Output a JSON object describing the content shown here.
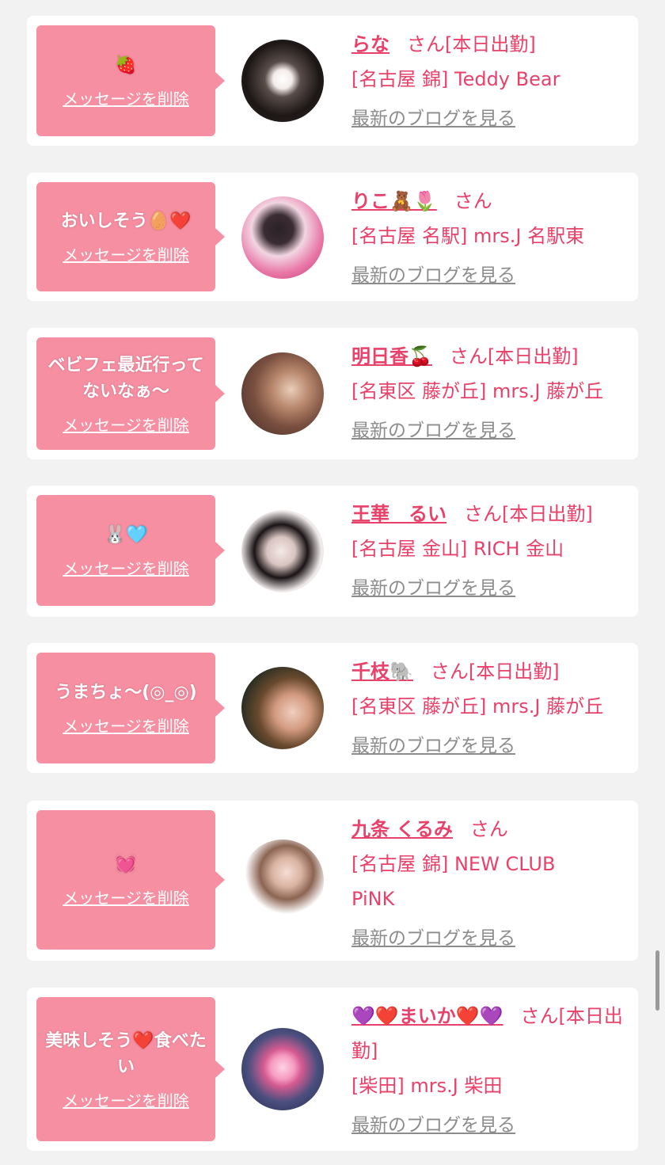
{
  "delete_label": "メッセージを削除",
  "blog_label": "最新のブログを見る",
  "colors": {
    "bubble": "#f68fa2",
    "accent": "#e8416a",
    "muted": "#8c8c8c"
  },
  "messages": [
    {
      "text": "🍓",
      "name": "らな",
      "honorific": "さん[本日出勤]",
      "shop": "[名古屋 錦] Teddy Bear"
    },
    {
      "text": "おいしそう🥚❤️",
      "name": "りこ🧸🌷",
      "honorific": "さん",
      "shop": "[名古屋 名駅] mrs.J 名駅東"
    },
    {
      "text": "ベビフェ最近行ってないなぁ〜",
      "name": "明日香🍒",
      "honorific": "さん[本日出勤]",
      "shop": "[名東区 藤が丘] mrs.J 藤が丘"
    },
    {
      "text": "🐰🩵",
      "name": "王華　るい",
      "honorific": "さん[本日出勤]",
      "shop": "[名古屋 金山] RICH 金山"
    },
    {
      "text": "うまちょ〜(◎_◎)",
      "name": "千枝🐘",
      "honorific": "さん[本日出勤]",
      "shop": "[名東区 藤が丘] mrs.J 藤が丘"
    },
    {
      "text": "💓",
      "name": "九条 くるみ",
      "honorific": "さん",
      "shop": "[名古屋 錦] NEW CLUB PiNK"
    },
    {
      "text": "美味しそう❤️食べたい",
      "name": "💜❤️まいか❤️💜",
      "honorific": "さん[本日出勤]",
      "shop": "[柴田] mrs.J 柴田"
    }
  ]
}
